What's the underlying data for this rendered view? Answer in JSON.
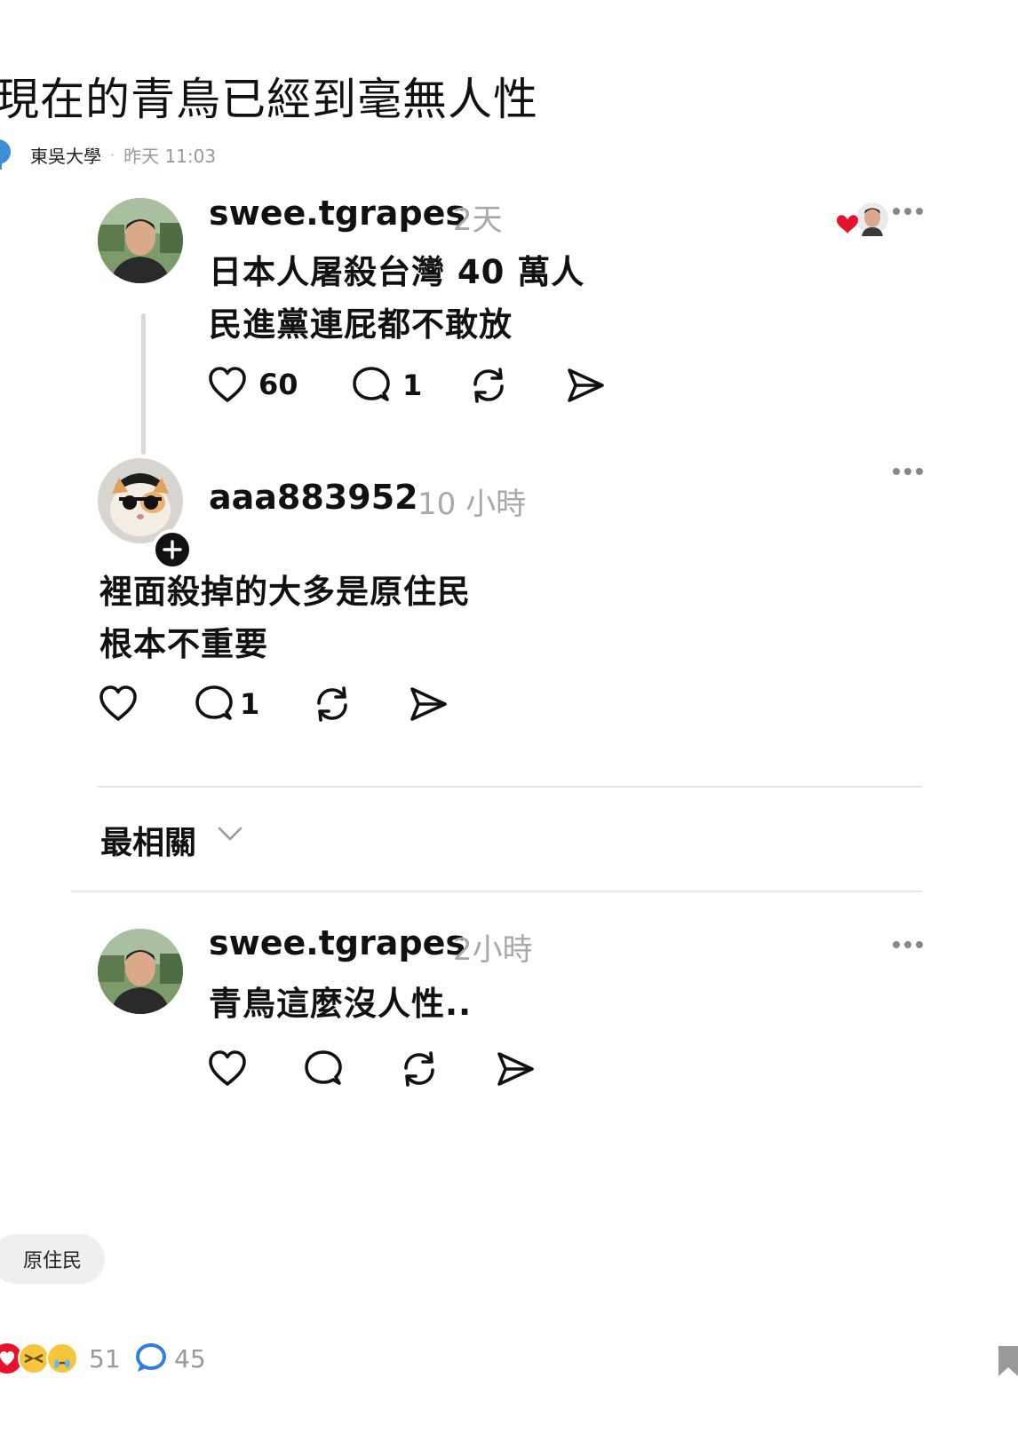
{
  "post": {
    "title": "現在的青鳥已經到毫無人性",
    "school": "東吳大學",
    "separator": "·",
    "time": "昨天 11:03",
    "tag": "原住民",
    "reaction_count": "51",
    "comment_count": "45"
  },
  "thread": [
    {
      "username": "swee.tgrapes",
      "timestamp": "2天",
      "lines": [
        "日本人屠殺台灣 40 萬人",
        "民進黨連屁都不敢放"
      ],
      "like_count": "60",
      "reply_count": "1"
    },
    {
      "username": "aaa883952",
      "timestamp": "10 小時",
      "lines": [
        "裡面殺掉的大多是原住民",
        "根本不重要"
      ],
      "like_count": "",
      "reply_count": "1"
    }
  ],
  "sort": {
    "label": "最相關"
  },
  "replies": [
    {
      "username": "swee.tgrapes",
      "timestamp": "2小時",
      "lines": [
        "青鳥這麼沒人性.."
      ]
    }
  ],
  "icons": {
    "like": "heart-icon",
    "reply": "speech-bubble-icon",
    "repost": "repost-icon",
    "share": "send-icon",
    "more": "more-horizontal-icon",
    "bookmark": "bookmark-icon"
  },
  "colors": {
    "heart_red": "#e8112d",
    "meta_gray": "#999999",
    "comment_blue": "#2f7fe0",
    "school_blue": "#3a8fd6"
  }
}
